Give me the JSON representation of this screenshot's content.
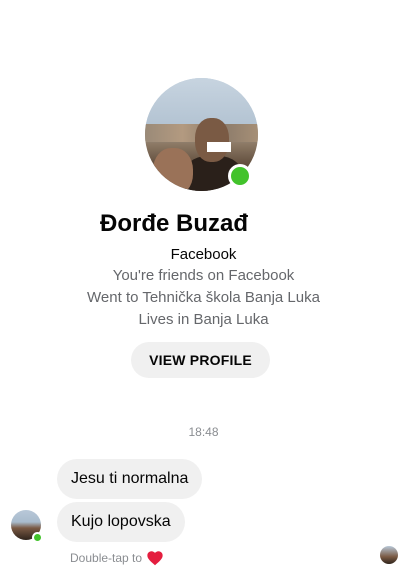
{
  "profile": {
    "name": "Đorđe Buzađ",
    "source": "Facebook",
    "info": [
      "You're friends on Facebook",
      "Went to Tehnička škola Banja Luka",
      "Lives in Banja Luka"
    ],
    "view_profile_label": "VIEW PROFILE",
    "online": true
  },
  "conversation": {
    "timestamp": "18:48",
    "messages": [
      {
        "text": "Jesu ti normalna"
      },
      {
        "text": "Kujo lopovska"
      }
    ],
    "reaction_hint": "Double-tap to"
  },
  "colors": {
    "online": "#42c32b",
    "bubble": "#f0f0f0",
    "heart": "#e41e3f"
  },
  "icons": {
    "reaction": "heart-icon"
  }
}
